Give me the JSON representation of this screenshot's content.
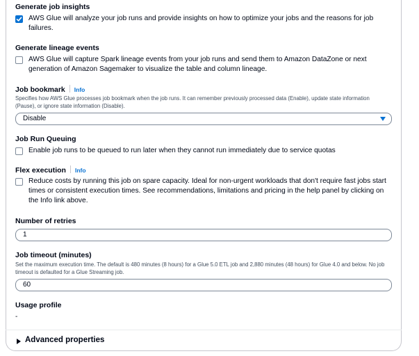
{
  "job_insights": {
    "label": "Generate job insights",
    "checked": true,
    "text": "AWS Glue will analyze your job runs and provide insights on how to optimize your jobs and the reasons for job failures."
  },
  "lineage": {
    "label": "Generate lineage events",
    "checked": false,
    "text": "AWS Glue will capture Spark lineage events from your job runs and send them to Amazon DataZone or next generation of Amazon Sagemaker to visualize the table and column lineage."
  },
  "bookmark": {
    "label": "Job bookmark",
    "info": "Info",
    "description": "Specifies how AWS Glue processes job bookmark when the job runs. It can remember previously processed data (Enable), update state information (Pause), or ignore state information (Disable).",
    "value": "Disable"
  },
  "queuing": {
    "label": "Job Run Queuing",
    "checked": false,
    "text": "Enable job runs to be queued to run later when they cannot run immediately due to service quotas"
  },
  "flex": {
    "label": "Flex execution",
    "info": "Info",
    "checked": false,
    "text": "Reduce costs by running this job on spare capacity. Ideal for non-urgent workloads that don't require fast jobs start times or consistent execution times. See recommendations, limitations and pricing in the help panel by clicking on the Info link above."
  },
  "retries": {
    "label": "Number of retries",
    "value": "1"
  },
  "timeout": {
    "label": "Job timeout (minutes)",
    "description": "Set the maximum execution time. The default is 480 minutes (8 hours) for a Glue 5.0 ETL job and 2,880 minutes (48 hours) for Glue 4.0 and below. No job timeout is defaulted for a Glue Streaming job.",
    "value": "60"
  },
  "usage_profile": {
    "label": "Usage profile",
    "value": "-"
  },
  "advanced": {
    "label": "Advanced properties"
  },
  "colors": {
    "accent": "#0972d3",
    "text": "#000716",
    "border": "#7d8998"
  }
}
